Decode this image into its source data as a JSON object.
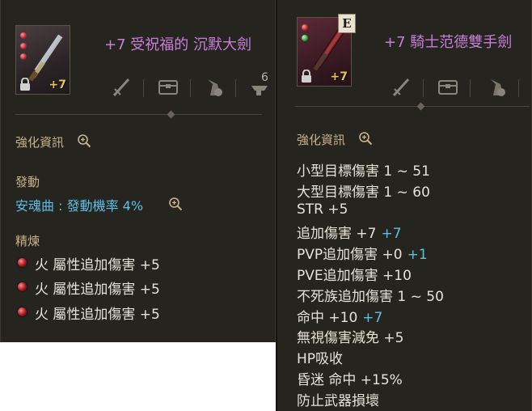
{
  "left": {
    "title": "+7 受祝福的 沉默大劍",
    "enchant_badge": "+7",
    "enchant_info_label": "強化資訊",
    "activation_label": "發動",
    "activation_effect": "安魂曲 : 發動機率 4%",
    "refine_label": "精煉",
    "refine_lines": [
      "火 屬性追加傷害 +5",
      "火 屬性追加傷害 +5",
      "火 屬性追加傷害 +5"
    ],
    "tab_partial_label": "6",
    "icons": [
      "sword-icon",
      "chest-icon",
      "pouch-icon",
      "anvil-icon"
    ]
  },
  "right": {
    "title": "+7 騎士范德雙手劍",
    "enchant_badge": "+7",
    "grade_badge": "E",
    "enchant_info_label": "強化資訊",
    "stats": [
      {
        "text": "小型目標傷害 1 ~ 51",
        "bonus": ""
      },
      {
        "text": "大型目標傷害 1 ~ 60",
        "bonus": ""
      },
      {
        "text": "STR +5",
        "bonus": ""
      },
      {
        "text": "追加傷害 +7",
        "bonus": "+7"
      },
      {
        "text": "PVP追加傷害 +0",
        "bonus": "+1"
      },
      {
        "text": "PVE追加傷害 +10",
        "bonus": ""
      },
      {
        "text": "不死族追加傷害 1 ~ 50",
        "bonus": ""
      },
      {
        "text": "命中 +10",
        "bonus": "+7"
      },
      {
        "text": "無視傷害減免 +5",
        "bonus": ""
      },
      {
        "text": "HP吸收",
        "bonus": ""
      },
      {
        "text": "昏迷 命中 +15%",
        "bonus": ""
      },
      {
        "text": "防止武器損壞",
        "bonus": ""
      }
    ],
    "icons": [
      "sword-icon",
      "chest-icon",
      "pouch-icon"
    ]
  },
  "colors": {
    "panel_bg": "#26241f",
    "title_purple": "#c77fd9",
    "label_gold": "#c8b28a",
    "bonus_cyan": "#5cc0e6",
    "text": "#e6e2d8"
  }
}
